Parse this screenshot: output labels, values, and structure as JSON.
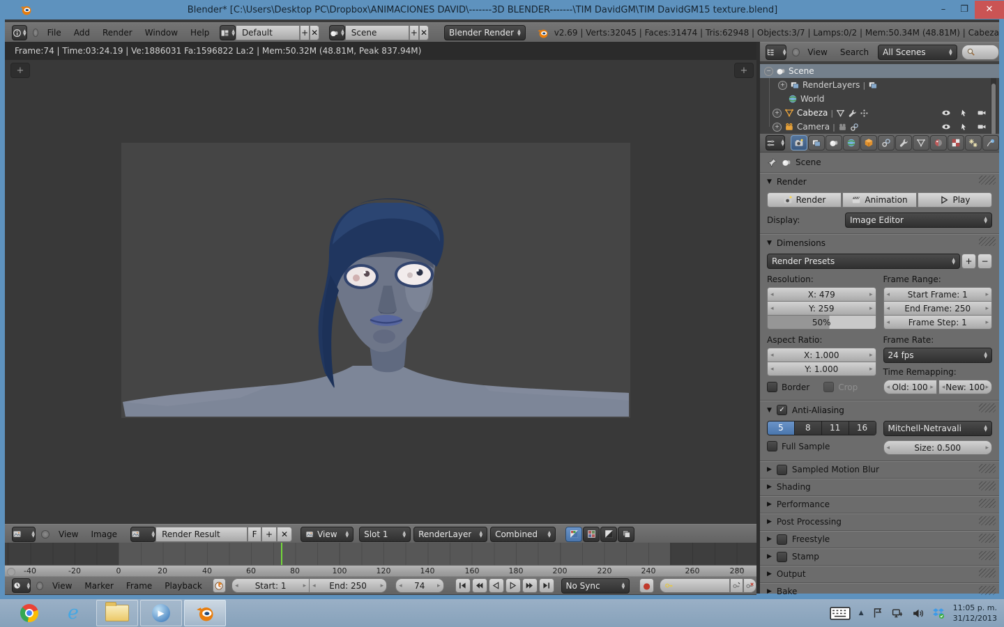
{
  "titlebar": {
    "title": "Blender* [C:\\Users\\Desktop PC\\Dropbox\\ANIMACIONES DAVID\\-------3D BLENDER-------\\TIM DavidGM\\TIM DavidGM15 texture.blend]",
    "minimize": "–",
    "maximize": "❐"
  },
  "glyphs": {
    "close": "✕",
    "plus": "+",
    "minus": "−",
    "check": "✓",
    "pipe": "|",
    "collapse": "▼",
    "expand": "▶",
    "record": "●",
    "up_chevron": "▲"
  },
  "topbar": {
    "menus": [
      "File",
      "Add",
      "Render",
      "Window",
      "Help"
    ],
    "layout_value": "Default",
    "scene_value": "Scene",
    "engine_value": "Blender Render",
    "stats": "v2.69 | Verts:32045 | Faces:31474 | Tris:62948 | Objects:3/7 | Lamps:0/2 | Mem:50.34M (48.81M) | Cabeza"
  },
  "render_stats": "Frame:74 | Time:03:24.19 | Ve:1886031 Fa:1596822 La:2 | Mem:50.32M (48.81M, Peak 837.94M)",
  "outliner": {
    "menus": [
      "View",
      "Search"
    ],
    "scope": "All Scenes",
    "rows": [
      {
        "label": "Scene"
      },
      {
        "label": "RenderLayers"
      },
      {
        "label": "World"
      },
      {
        "label": "Cabeza"
      },
      {
        "label": "Camera"
      }
    ]
  },
  "properties": {
    "context": "Scene",
    "render": {
      "title": "Render",
      "render_btn": "Render",
      "animation_btn": "Animation",
      "play_btn": "Play",
      "display_label": "Display:",
      "display_value": "Image Editor"
    },
    "dimensions": {
      "title": "Dimensions",
      "presets": "Render Presets",
      "resolution_label": "Resolution:",
      "res_x": "X: 479",
      "res_y": "Y: 259",
      "res_pct": "50%",
      "frame_range_label": "Frame Range:",
      "start": "Start Frame: 1",
      "end": "End Frame: 250",
      "step": "Frame Step: 1",
      "aspect_label": "Aspect Ratio:",
      "asp_x": "X: 1.000",
      "asp_y": "Y: 1.000",
      "frame_rate_label": "Frame Rate:",
      "fps": "24 fps",
      "remap_label": "Time Remapping:",
      "old": "Old: 100",
      "new": "New: 100",
      "border": "Border",
      "crop": "Crop"
    },
    "aa": {
      "title": "Anti-Aliasing",
      "samples": [
        "5",
        "8",
        "11",
        "16"
      ],
      "selected_sample": "5",
      "filter": "Mitchell-Netravali",
      "full_sample": "Full Sample",
      "size": "Size: 0.500"
    },
    "collapsed": [
      {
        "label": "Sampled Motion Blur"
      },
      {
        "label": "Shading"
      },
      {
        "label": "Performance"
      },
      {
        "label": "Post Processing"
      },
      {
        "label": "Freestyle"
      },
      {
        "label": "Stamp"
      },
      {
        "label": "Output"
      },
      {
        "label": "Bake"
      }
    ]
  },
  "image_editor": {
    "menus": [
      "View",
      "Image"
    ],
    "datablock": "Render Result",
    "fake_user": "F",
    "view_menu": "View",
    "slot": "Slot 1",
    "layer": "RenderLayer",
    "pass": "Combined"
  },
  "timeline": {
    "menus": [
      "View",
      "Marker",
      "Frame",
      "Playback"
    ],
    "start": "Start: 1",
    "end": "End: 250",
    "current": "74",
    "sync": "No Sync",
    "ticks": [
      "-40",
      "-20",
      "0",
      "20",
      "40",
      "60",
      "80",
      "100",
      "120",
      "140",
      "160",
      "180",
      "200",
      "220",
      "240",
      "260",
      "280"
    ]
  },
  "taskbar": {
    "time": "11:05 p. m.",
    "date": "31/12/2013"
  },
  "colors": {
    "titlebar_blue": "#5e92be",
    "close_red": "#ca5454",
    "accent_blue": "#4a76ad",
    "playhead_green": "#74d83a"
  }
}
